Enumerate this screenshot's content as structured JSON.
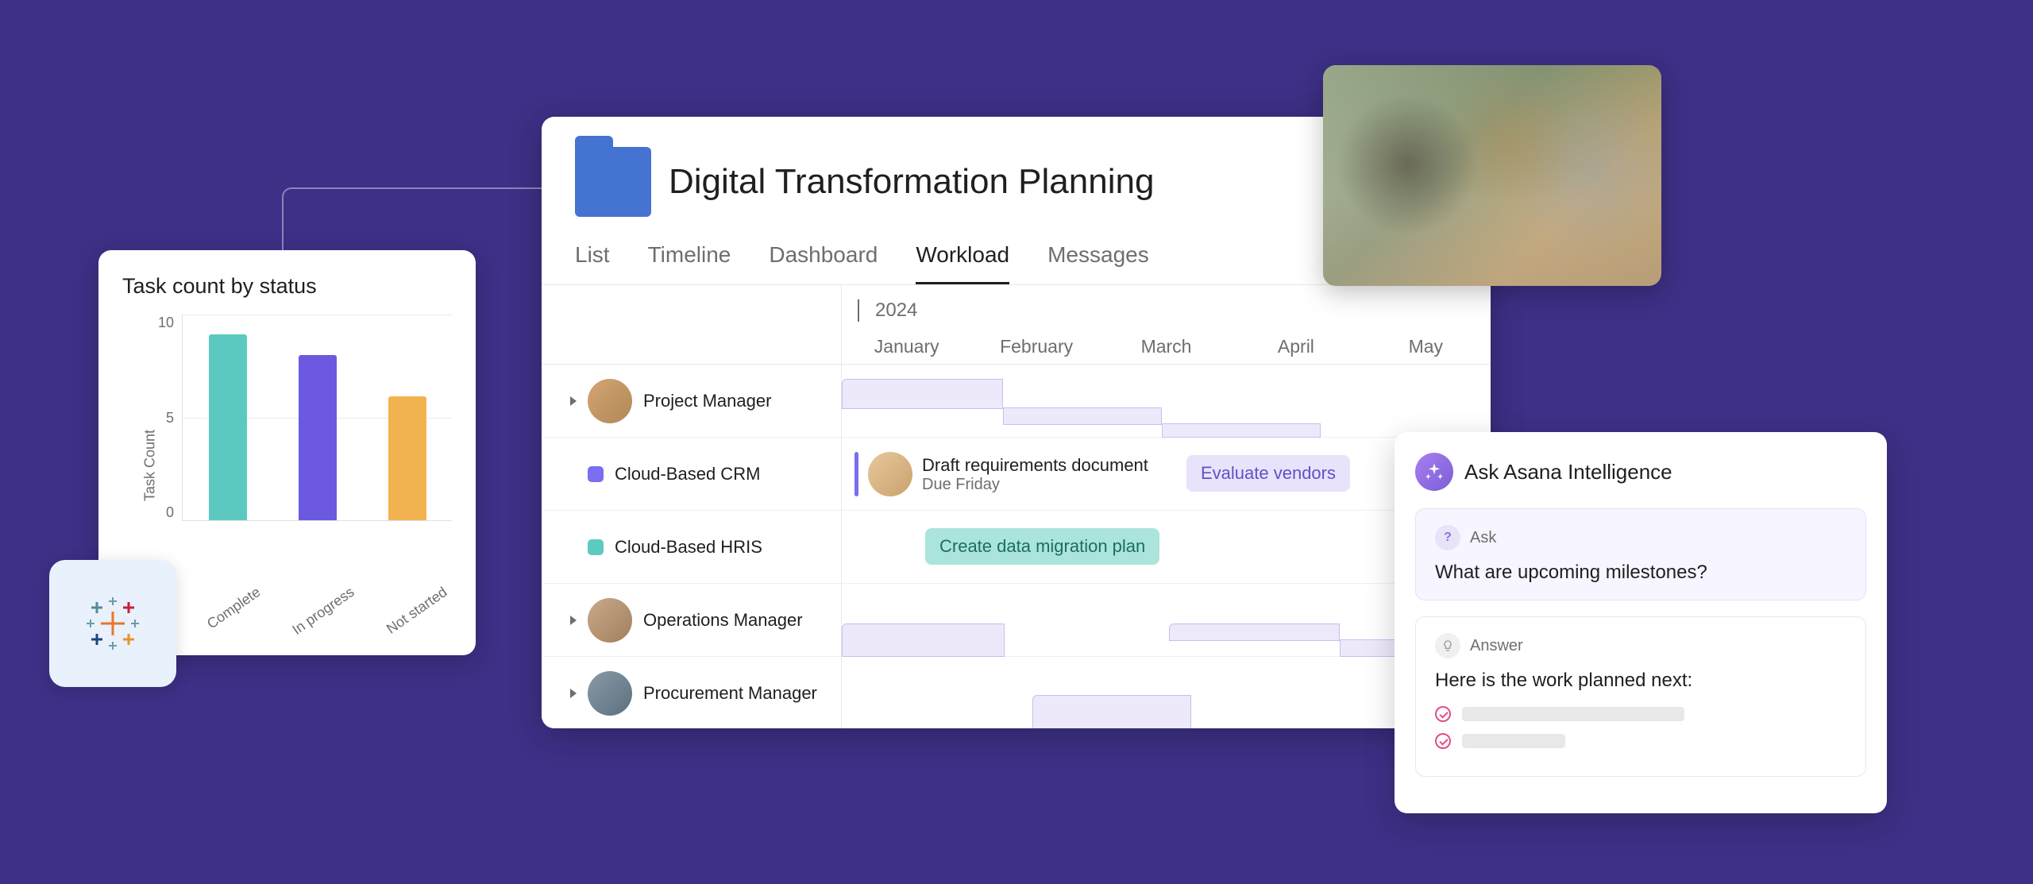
{
  "chart": {
    "title": "Task count by status",
    "ylabel": "Task Count",
    "y_ticks": [
      "10",
      "5",
      "0"
    ],
    "categories": [
      "Complete",
      "In progress",
      "Not started"
    ]
  },
  "chart_data": {
    "type": "bar",
    "title": "Task count by status",
    "xlabel": "",
    "ylabel": "Task Count",
    "ylim": [
      0,
      10
    ],
    "categories": [
      "Complete",
      "In progress",
      "Not started"
    ],
    "series": [
      {
        "name": "Task Count",
        "values": [
          9,
          8,
          6
        ]
      }
    ],
    "colors": [
      "#5cc9c0",
      "#6b5ae0",
      "#f1b350"
    ]
  },
  "main": {
    "title": "Digital Transformation Planning",
    "tabs": [
      "List",
      "Timeline",
      "Dashboard",
      "Workload",
      "Messages"
    ],
    "active_tab": "Workload",
    "year": "2024",
    "months": [
      "January",
      "February",
      "March",
      "April",
      "May"
    ],
    "rows": {
      "r0": {
        "label": "Project Manager"
      },
      "r1": {
        "label": "Cloud-Based CRM",
        "color": "#7a6ff0"
      },
      "r2": {
        "label": "Cloud-Based HRIS",
        "color": "#5ec9bf"
      },
      "r3": {
        "label": "Operations Manager"
      },
      "r4": {
        "label": "Procurement Manager"
      }
    },
    "tasks": {
      "draft": {
        "title": "Draft requirements document",
        "sub": "Due Friday",
        "accent": "#7a6ff0"
      },
      "evaluate": {
        "label": "Evaluate vendors",
        "bg": "#e8e3fa",
        "fg": "#5e52c7"
      },
      "migration": {
        "label": "Create data migration plan",
        "bg": "#b7e8e0",
        "fg": "#1a6e62"
      }
    }
  },
  "ai": {
    "title": "Ask Asana Intelligence",
    "ask_label": "Ask",
    "ask_text": "What are upcoming milestones?",
    "answer_label": "Answer",
    "answer_text": "Here is the work planned next:"
  }
}
